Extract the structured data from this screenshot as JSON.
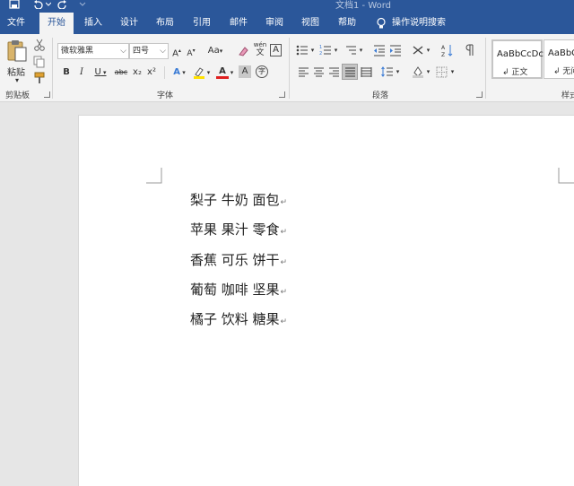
{
  "window": {
    "title": "文档1 - Word"
  },
  "tabs": [
    {
      "label": "文件"
    },
    {
      "label": "开始"
    },
    {
      "label": "插入"
    },
    {
      "label": "设计"
    },
    {
      "label": "布局"
    },
    {
      "label": "引用"
    },
    {
      "label": "邮件"
    },
    {
      "label": "审阅"
    },
    {
      "label": "视图"
    },
    {
      "label": "帮助"
    },
    {
      "label": "操作说明搜索"
    }
  ],
  "active_tab": "开始",
  "ribbon": {
    "clipboard": {
      "paste_label": "粘贴",
      "group_label": "剪贴板"
    },
    "font": {
      "font_name": "微软雅黑",
      "font_size": "四号",
      "change_case": "Aa",
      "group_label": "字体",
      "bold": "B",
      "italic": "I",
      "underline": "U",
      "strike": "abc",
      "subscript": "x₂",
      "superscript": "x²",
      "grow": "A",
      "shrink": "A",
      "char_border": "A",
      "phonetic": "wén",
      "phonetic_char": "文",
      "font_color": "A",
      "text_effect": "A",
      "enclose": "字"
    },
    "paragraph": {
      "group_label": "段落"
    },
    "styles": {
      "items": [
        {
          "sample": "AaBbCcDc",
          "name": "↲ 正文"
        },
        {
          "sample": "AaBbC",
          "name": "↲ 无间"
        }
      ],
      "group_label": "样式"
    }
  },
  "document": {
    "lines": [
      "梨子 牛奶 面包",
      "苹果 果汁 零食",
      "香蕉 可乐 饼干",
      "葡萄 咖啡 坚果",
      "橘子 饮料 糖果"
    ],
    "paragraph_mark": "↵"
  },
  "colors": {
    "ribbon_blue": "#2b579a",
    "ribbon_bg": "#f3f3f3",
    "workspace": "#e6e6e6"
  }
}
